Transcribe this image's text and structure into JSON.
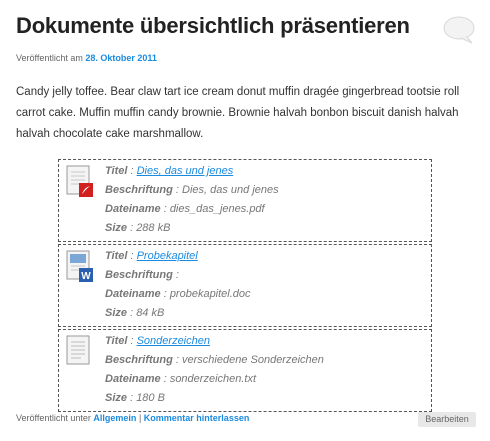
{
  "post": {
    "title": "Dokumente übersichtlich präsentieren",
    "published_prefix": "Veröffentlicht am",
    "published_date": "28. Oktober 2011",
    "body": "Candy jelly toffee. Bear claw tart ice cream donut muffin dragée gingerbread tootsie roll carrot cake. Muffin muffin candy brownie. Brownie halvah bonbon biscuit danish halvah halvah chocolate cake marshmallow."
  },
  "labels": {
    "title": "Titel",
    "caption": "Beschriftung",
    "filename": "Dateiname",
    "size": "Size",
    "sep": " : "
  },
  "attachments": [
    {
      "icon": "pdf-file-icon",
      "title": "Dies, das und jenes",
      "caption": "Dies, das und jenes",
      "filename": "dies_das_jenes.pdf",
      "size": "288 kB"
    },
    {
      "icon": "word-file-icon",
      "title": "Probekapitel",
      "caption": "",
      "filename": "probekapitel.doc",
      "size": "84 kB"
    },
    {
      "icon": "text-file-icon",
      "title": "Sonderzeichen",
      "caption": "verschiedene Sonderzeichen",
      "filename": "sonderzeichen.txt",
      "size": "180 B"
    }
  ],
  "footer": {
    "prefix": "Veröffentlicht unter",
    "category": "Allgemein",
    "divider": "|",
    "comment_link": "Kommentar hinterlassen",
    "edit_label": "Bearbeiten"
  },
  "colors": {
    "link": "#1b8be0",
    "text": "#333333",
    "muted": "#777777"
  }
}
